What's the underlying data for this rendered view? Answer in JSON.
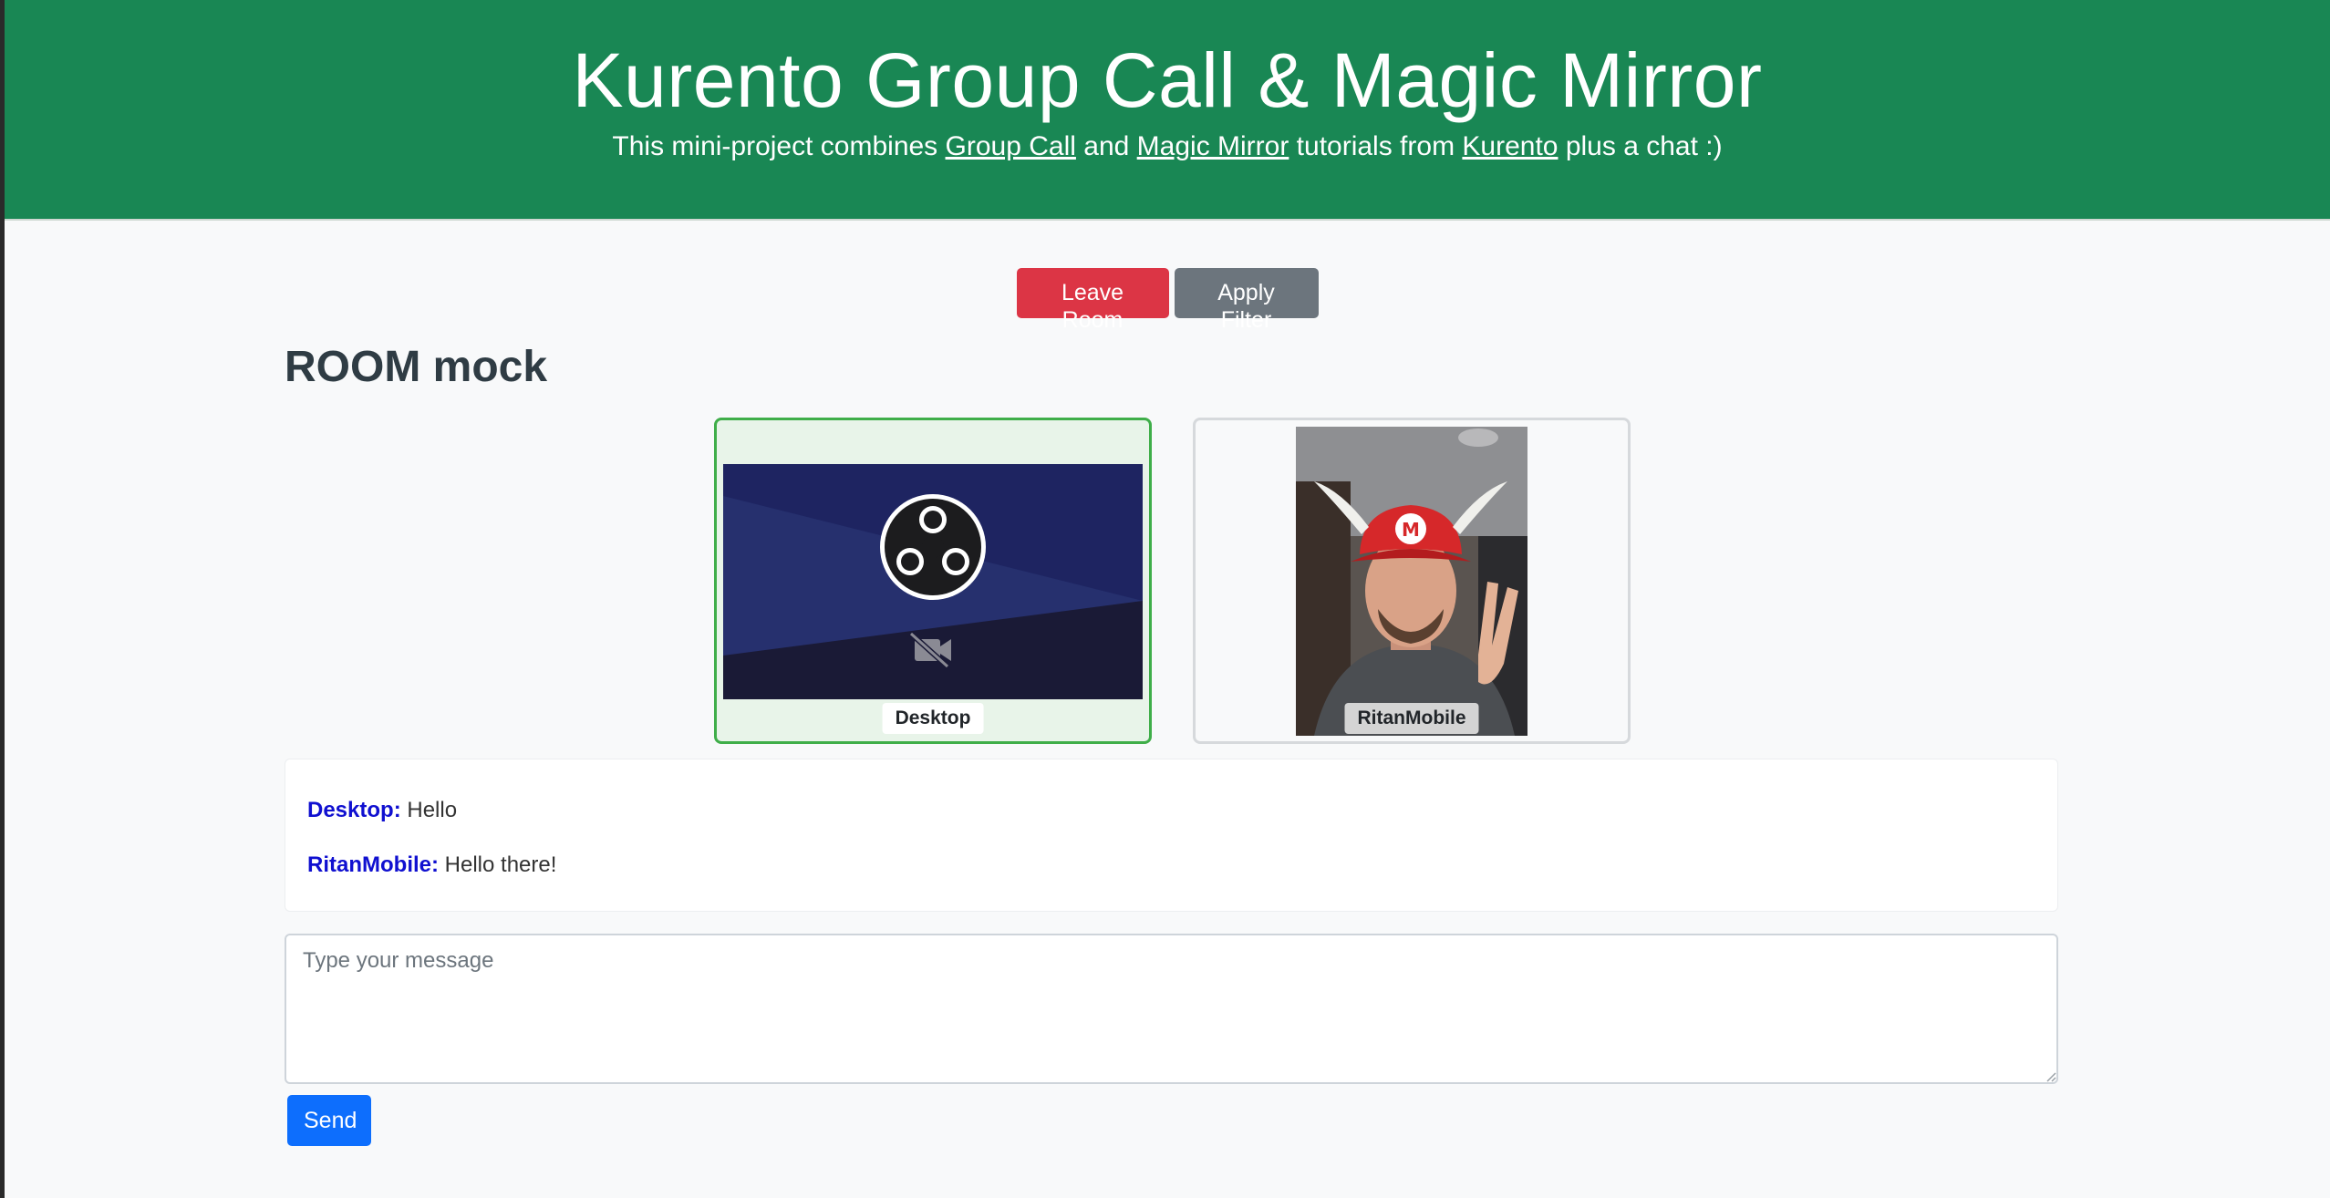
{
  "header": {
    "title": "Kurento Group Call & Magic Mirror",
    "subtitle_pre": "This mini-project combines ",
    "link_group_call": "Group Call",
    "subtitle_and": " and ",
    "link_magic_mirror": "Magic Mirror",
    "subtitle_mid": " tutorials from ",
    "link_kurento": "Kurento",
    "subtitle_post": " plus a chat :)"
  },
  "actions": {
    "leave_label": "Leave Room",
    "filter_label": "Apply Filter"
  },
  "room": {
    "title": "ROOM mock"
  },
  "participants": [
    {
      "name": "Desktop",
      "video_icon": "camera-off-icon",
      "logo": "obs-logo"
    },
    {
      "name": "RitanMobile"
    }
  ],
  "chat": {
    "messages": [
      {
        "sender": "Desktop:",
        "text": " Hello"
      },
      {
        "sender": "RitanMobile:",
        "text": " Hello there!"
      }
    ],
    "placeholder": "Type your message",
    "send_label": "Send"
  },
  "colors": {
    "header_bg": "#198754",
    "danger": "#dc3545",
    "secondary": "#6c757d",
    "primary": "#0d6efd",
    "sender": "#1010d0",
    "active_tile_border": "#3fae49"
  }
}
